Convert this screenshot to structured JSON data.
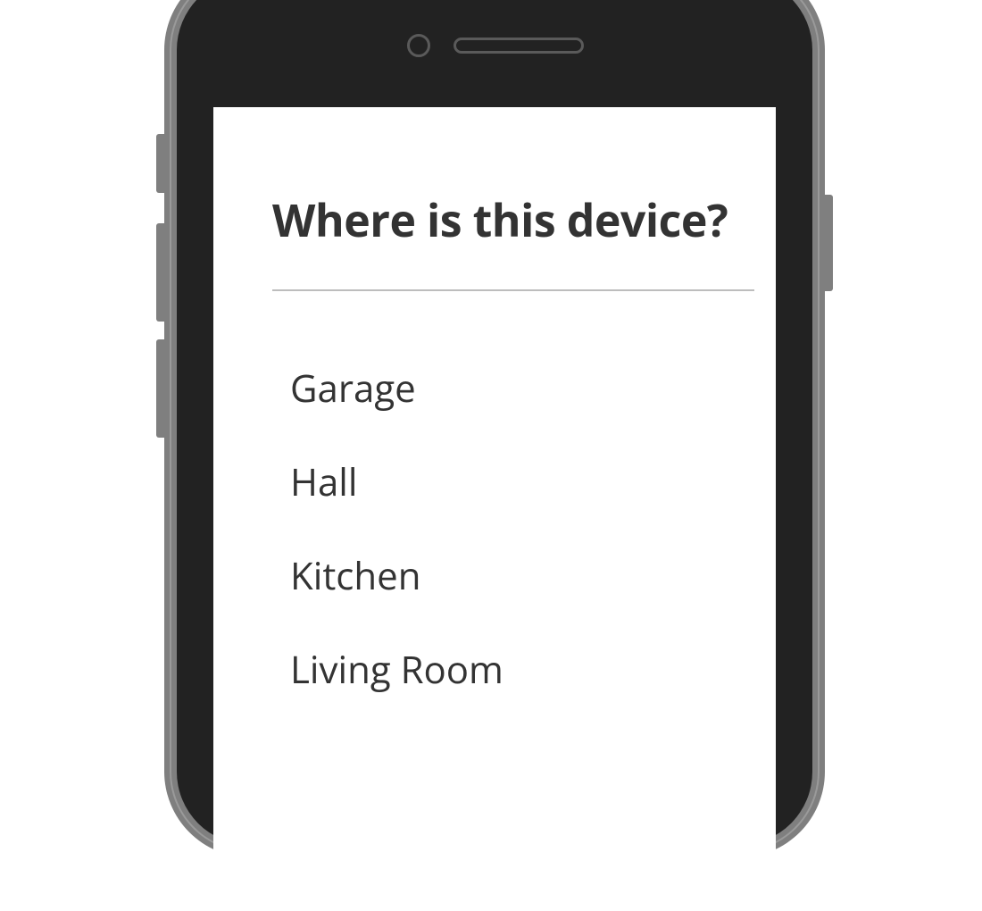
{
  "screen": {
    "title": "Where is this device?",
    "options": [
      {
        "label": "Garage"
      },
      {
        "label": "Hall"
      },
      {
        "label": "Kitchen"
      },
      {
        "label": "Living Room"
      }
    ]
  }
}
